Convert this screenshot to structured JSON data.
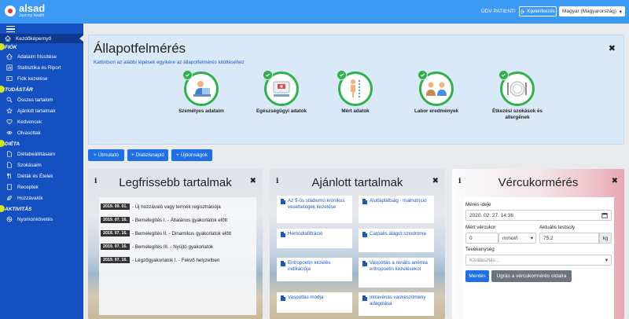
{
  "header": {
    "logo_name": "alsad",
    "logo_tagline": "Just my health",
    "greeting": "ÜDV PATIENT!",
    "logout_label": "Kijelentkezés",
    "language": "Magyar (Magyarország)"
  },
  "sidebar": {
    "active_label": "Kezdőképernyő",
    "sections": [
      {
        "title": "FIÓK",
        "items": [
          "Adataim frissítése",
          "Statisztika és Riport",
          "Fiók kezelése"
        ]
      },
      {
        "title": "TUDÁSTÁR",
        "items": [
          "Összes tartalom",
          "Ajánlott tartalmak",
          "Kedvencek",
          "Olvasottak"
        ]
      },
      {
        "title": "DIÉTA",
        "items": [
          "Diétabeállításaim",
          "Szokásaim",
          "Diéták és Ételek",
          "Receptek",
          "Hozzávalók"
        ]
      },
      {
        "title": "AKTIVITÁS",
        "items": [
          "Nyomonkövetés"
        ]
      }
    ]
  },
  "assessment": {
    "title": "Állapotfelmérés",
    "subtitle": "Kattintson az alábbi lépések egyikére az állapotfelmérés kitöltéséhez",
    "steps": [
      "Személyes adataim",
      "Egészségügyi adatok",
      "Mért adatok",
      "Labor eredmények",
      "Étkezési szokások és allergének"
    ]
  },
  "actions": {
    "utmutato": "+ Útmutató",
    "dializisnaplo": "+ Dializisnapló",
    "ujdonsagok": "+ Újdonságok"
  },
  "latest": {
    "title": "Legfrissebb tartalmak",
    "rows": [
      {
        "date": "2019. 09. 01.",
        "text": "- Új hozzávaló vagy termék regisztrációja"
      },
      {
        "date": "2019. 07. 16.",
        "text": "- Bemelegítés I. - Általános gyakorlatok előtt"
      },
      {
        "date": "2019. 07. 16.",
        "text": "- Bemelegítés II. - Dinamikus gyakorlatok előtt"
      },
      {
        "date": "2019. 07. 16.",
        "text": "- Bemelegítés III. - Nyújtó gyakorlatok"
      },
      {
        "date": "2019. 07. 16.",
        "text": "- Légzőgyakorlatok I. - Fekvő helyzetben"
      }
    ]
  },
  "recommended": {
    "title": "Ajánlott tartalmak",
    "items": [
      "Az 5-ös stádiumú krónikus vesebetegek kezelése",
      "Alultápláltság - malnutríció",
      "Hemodiafiltráció",
      "Carpalis alagút-szindróma",
      "Eritropoetin kezelés indikációja",
      "Vaspótlás a renális anémia eritropoetin kezelésekor",
      "Vaspótlás módja",
      "Intravénás vaskészítmény adagolása"
    ]
  },
  "glucose": {
    "title": "Vércukormérés",
    "date_label": "Mérés ideje",
    "date_value": "2020. 02. 27. 14:36",
    "glucose_label": "Mért vércukor",
    "glucose_value": "0",
    "unit": "mmol/l",
    "weight_label": "Aktuális testsúly",
    "weight_value": "75,2",
    "weight_unit": "kg",
    "activity_label": "Tevékenység",
    "activity_placeholder": "Kiválasztás...",
    "save_label": "Mentés",
    "goto_label": "Ugrás a vércukormérés oldalra"
  },
  "colors": {
    "topbar": "#3c9af4",
    "sidebar": "#1450bf",
    "accent": "#1f6fe6",
    "check": "#2db24a",
    "section_dot": "#d4e817"
  }
}
